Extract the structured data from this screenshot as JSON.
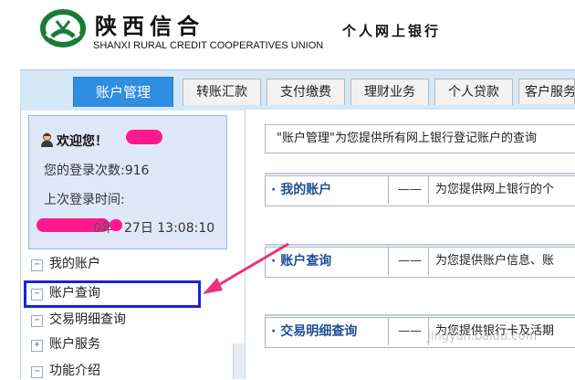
{
  "header": {
    "brand_cn": "陕西信合",
    "brand_en": "SHANXI RURAL CREDIT COOPERATIVES UNION",
    "bank_title": "个人网上银行"
  },
  "nav": {
    "tabs": [
      {
        "label": "账户管理",
        "active": true
      },
      {
        "label": "转账汇款",
        "active": false
      },
      {
        "label": "支付缴费",
        "active": false
      },
      {
        "label": "理财业务",
        "active": false
      },
      {
        "label": "个人贷款",
        "active": false
      },
      {
        "label": "客户服务",
        "active": false
      }
    ]
  },
  "welcome": {
    "greeting": "欢迎您！",
    "login_count": "您的登录次数:916",
    "last_login_label": "上次登录时间:",
    "last_login_time_visible": "27日 13:08:10",
    "last_login_fragment": "0年"
  },
  "menu": {
    "items": [
      {
        "label": "我的账户",
        "symbol": "−"
      },
      {
        "label": "账户查询",
        "symbol": "−"
      },
      {
        "label": "交易明细查询",
        "symbol": "−"
      },
      {
        "label": "账户服务",
        "symbol": "+"
      },
      {
        "label": "功能介绍",
        "symbol": "−"
      }
    ]
  },
  "content": {
    "description": "\"账户管理\"为您提供所有网上银行登记账户的查询",
    "services": [
      {
        "name": "· 我的账户",
        "dash": "——",
        "text": "为您提供网上银行的个"
      },
      {
        "name": "· 账户查询",
        "dash": "——",
        "text": "为您提供账户信息、账"
      },
      {
        "name": "· 交易明细查询",
        "dash": "——",
        "text": "为您提供银行卡及活期"
      }
    ]
  },
  "watermark": "Jingyan.baidu.com",
  "colors": {
    "active_tab": "#2f8ee0",
    "nav_bar": "#d5e8f7",
    "welcome_bg": "#dfe8f8",
    "service_name": "#1f4f96",
    "highlight": "#1a24d8",
    "arrow": "#e8337e",
    "logo_green": "#1a7a3a"
  }
}
